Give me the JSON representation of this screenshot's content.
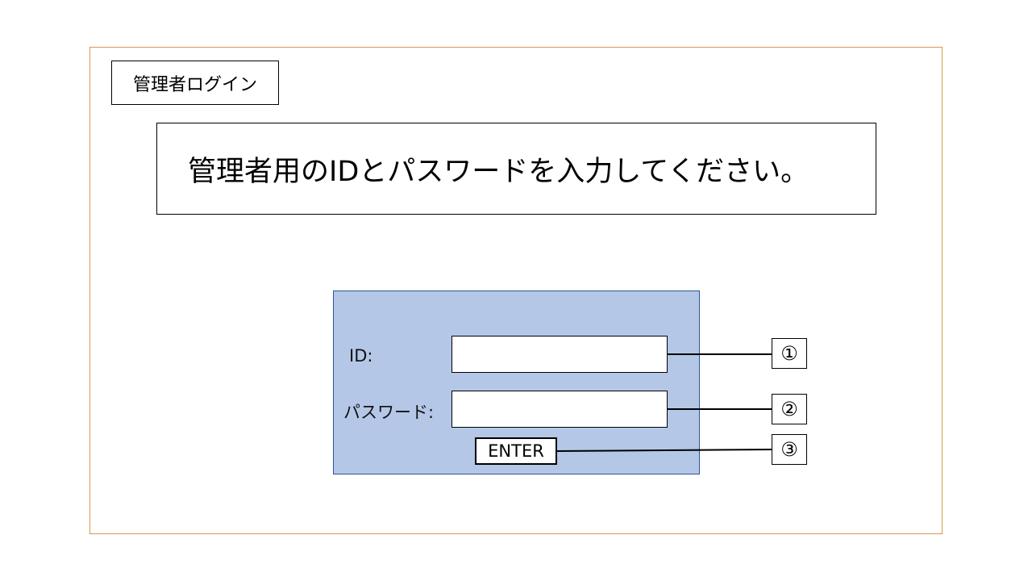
{
  "header": {
    "title": "管理者ログイン"
  },
  "instruction": {
    "text": "管理者用のIDとパスワードを入力してください。"
  },
  "login_form": {
    "id_label": "ID:",
    "id_value": "",
    "password_label": "パスワード:",
    "password_value": "",
    "enter_label": "ENTER"
  },
  "annotations": {
    "id_field_marker": "①",
    "password_field_marker": "②",
    "enter_button_marker": "③"
  },
  "colors": {
    "frame_border": "#d9974a",
    "panel_fill": "#b4c7e7",
    "panel_border": "#2f5597"
  }
}
